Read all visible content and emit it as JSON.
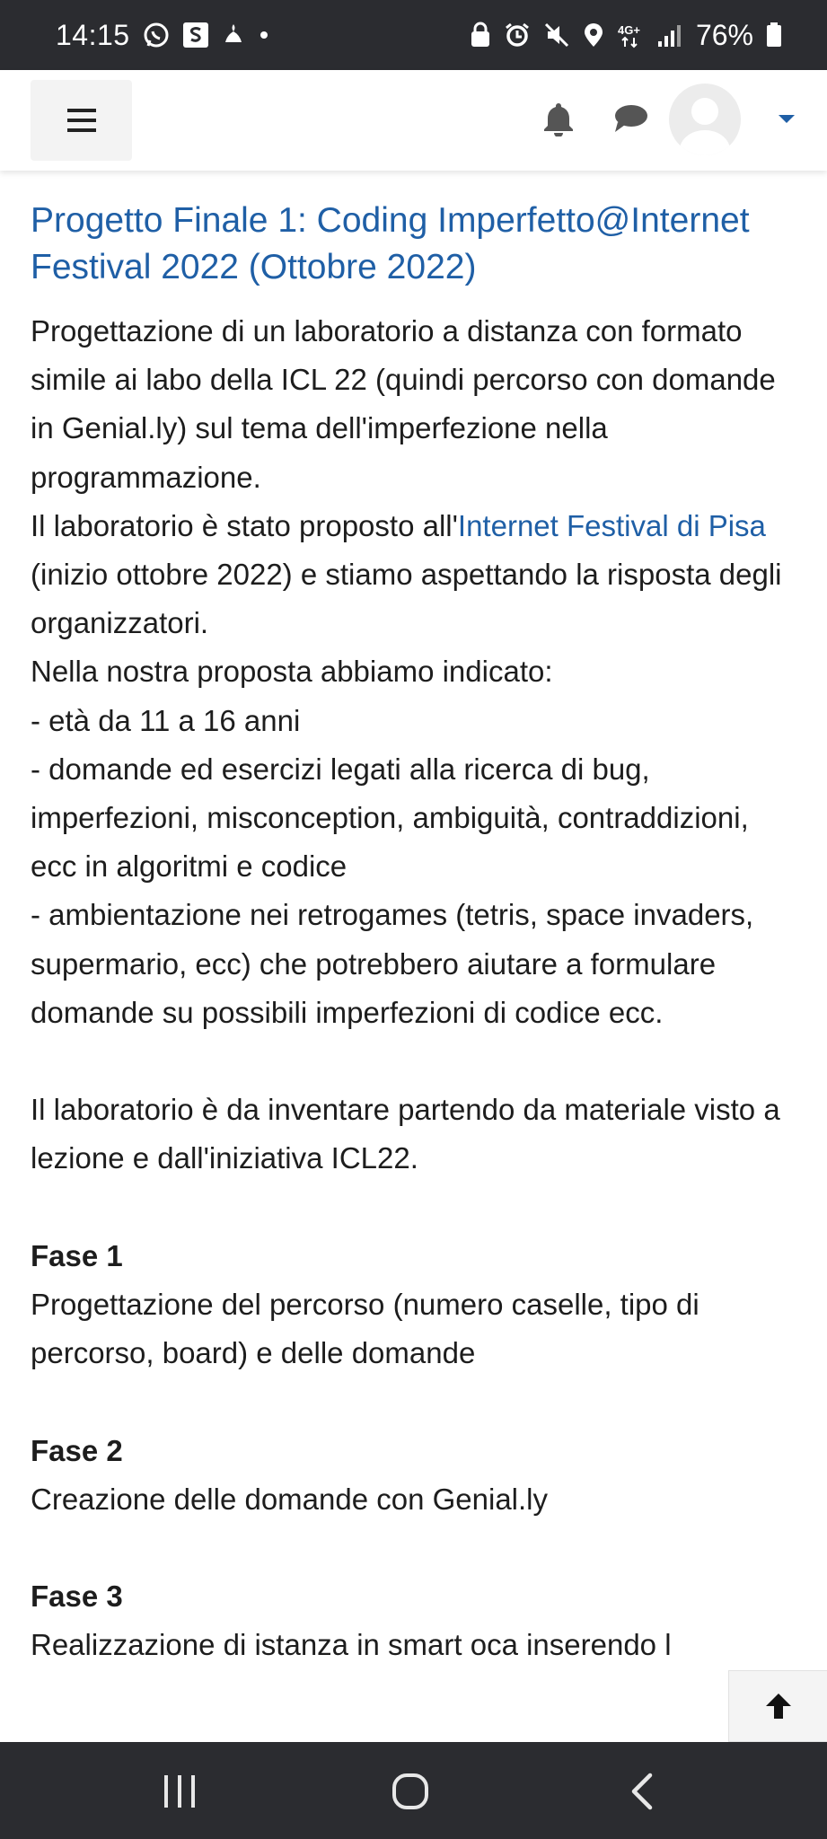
{
  "status_bar": {
    "time": "14:15",
    "battery": "76%",
    "icons": [
      "whatsapp-icon",
      "s-app-icon",
      "notification-icon",
      "dot-icon",
      "lock-icon",
      "alarm-icon",
      "mute-icon",
      "location-icon",
      "4g-icon",
      "signal-icon",
      "battery-icon"
    ]
  },
  "navbar": {
    "menu_icon": "hamburger-icon",
    "notification_icon": "bell-icon",
    "messages_icon": "chat-icon",
    "user_icon": "avatar",
    "dropdown_icon": "caret-down-icon"
  },
  "content": {
    "title": "Progetto Finale 1: Coding Imperfetto@Internet Festival 2022 (Ottobre 2022)",
    "intro": "Progettazione di un laboratorio a distanza con formato simile ai labo della ICL 22 (quindi percorso con domande in Genial.ly) sul tema dell'imperfezione nella programmazione.",
    "lab_before_link": "Il laboratorio è stato proposto all'",
    "lab_link": "Internet Festival di Pisa",
    "lab_after_link": " (inizio ottobre 2022) e stiamo aspettando la risposta degli organizzatori.",
    "proposal_intro": "Nella nostra proposta abbiamo indicato:",
    "bullets": [
      "- età da 11 a 16 anni",
      "- domande ed esercizi legati alla ricerca di bug, imperfezioni, misconception, ambiguità, contraddizioni, ecc in algoritmi e codice",
      "- ambientazione nei retrogames (tetris, space invaders, supermario, ecc) che potrebbero aiutare a formulare domande su possibili imperfezioni di codice ecc."
    ],
    "invent": "Il laboratorio è da inventare partendo da materiale visto a lezione e dall'iniziativa ICL22.",
    "phases": [
      {
        "title": "Fase 1",
        "text": "Progettazione del percorso (numero caselle, tipo di percorso, board) e delle domande"
      },
      {
        "title": "Fase 2",
        "text": "Creazione delle domande con Genial.ly"
      },
      {
        "title": "Fase 3",
        "text": "Realizzazione di istanza in smart oca inserendo l"
      }
    ]
  },
  "scroll_top": {
    "icon": "arrow-up-icon"
  },
  "bottom_nav": {
    "recents": "recents-icon",
    "home": "home-icon",
    "back": "back-icon"
  },
  "colors": {
    "status_bar_bg": "#2b2c30",
    "link": "#1f5fa6",
    "text": "#1d1d1d",
    "nav_bg": "#ffffff"
  }
}
